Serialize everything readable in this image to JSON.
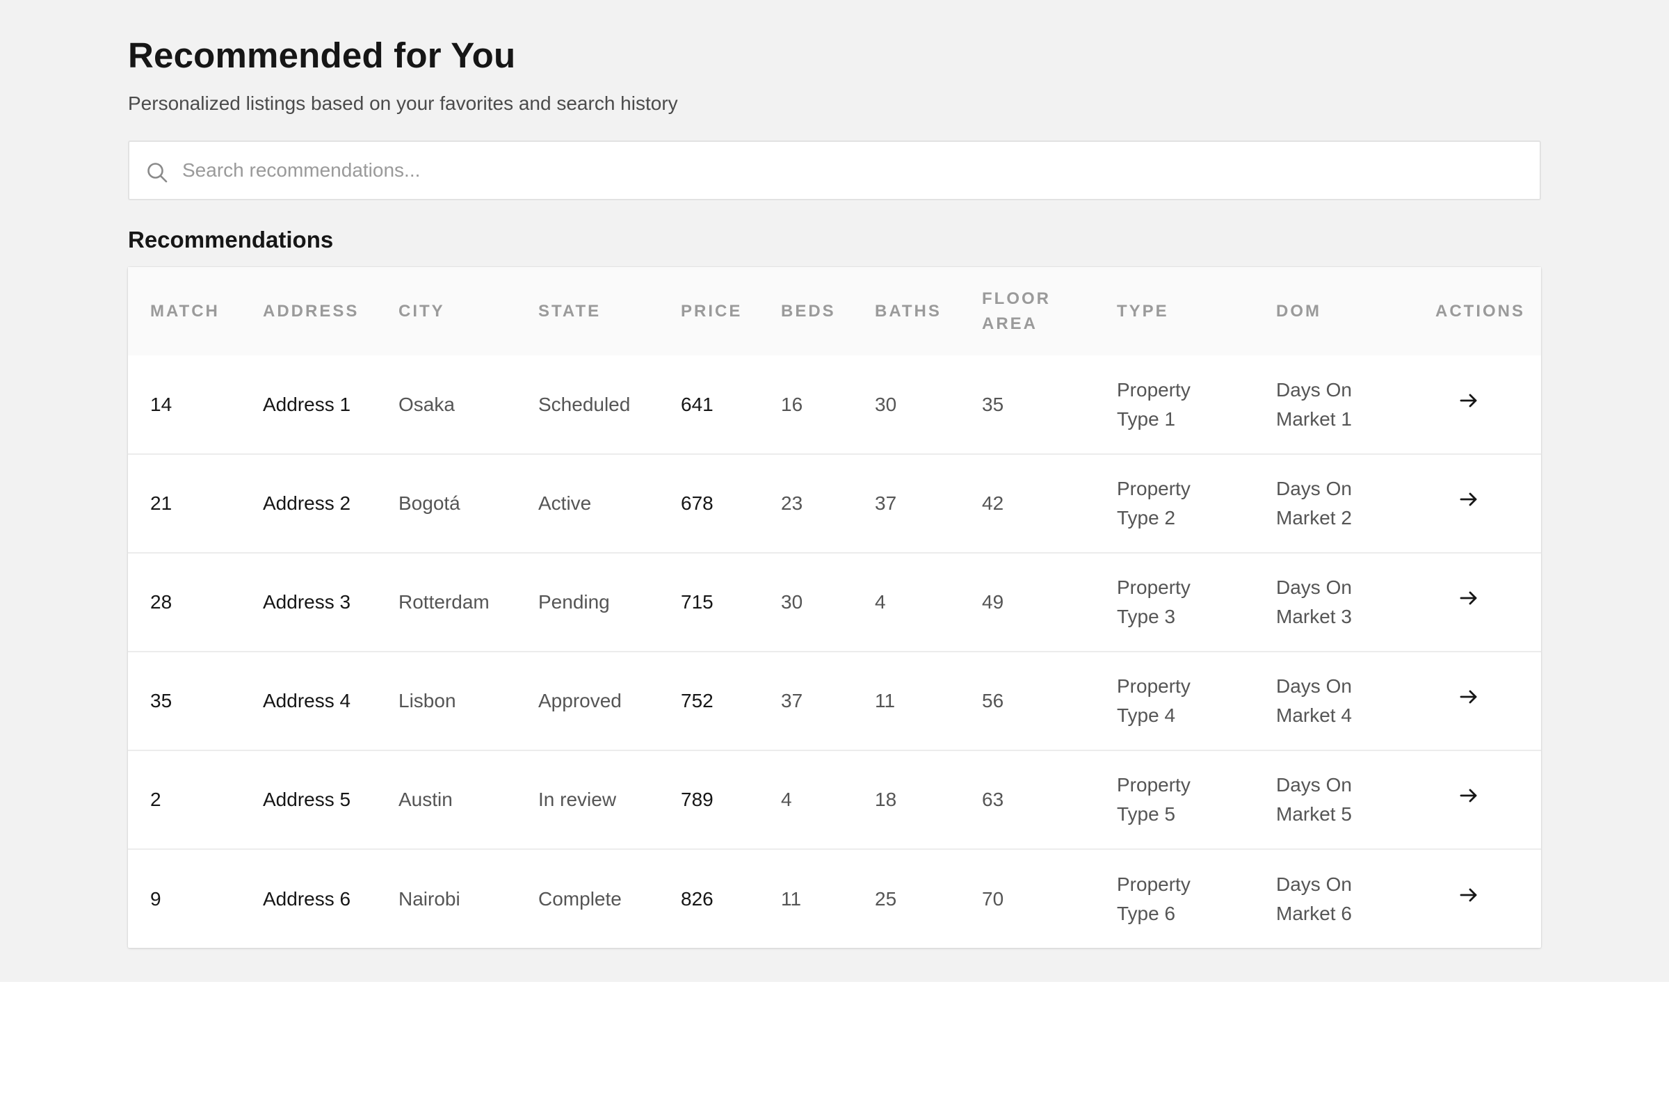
{
  "header": {
    "title": "Recommended for You",
    "subtitle": "Personalized listings based on your favorites and search history"
  },
  "search": {
    "placeholder": "Search recommendations...",
    "icon": "search-icon"
  },
  "section": {
    "heading": "Recommendations"
  },
  "table": {
    "columns": [
      "MATCH",
      "ADDRESS",
      "CITY",
      "STATE",
      "PRICE",
      "BEDS",
      "BATHS",
      "FLOOR AREA",
      "TYPE",
      "DOM",
      "ACTIONS"
    ],
    "rows": [
      {
        "match": "14",
        "address": "Address 1",
        "city": "Osaka",
        "state": "Scheduled",
        "price": "641",
        "beds": "16",
        "baths": "30",
        "floor_area": "35",
        "type": "Property Type 1",
        "dom": "Days On Market 1",
        "action_icon": "arrow-right-icon"
      },
      {
        "match": "21",
        "address": "Address 2",
        "city": "Bogotá",
        "state": "Active",
        "price": "678",
        "beds": "23",
        "baths": "37",
        "floor_area": "42",
        "type": "Property Type 2",
        "dom": "Days On Market 2",
        "action_icon": "arrow-right-icon"
      },
      {
        "match": "28",
        "address": "Address 3",
        "city": "Rotterdam",
        "state": "Pending",
        "price": "715",
        "beds": "30",
        "baths": "4",
        "floor_area": "49",
        "type": "Property Type 3",
        "dom": "Days On Market 3",
        "action_icon": "arrow-right-icon"
      },
      {
        "match": "35",
        "address": "Address 4",
        "city": "Lisbon",
        "state": "Approved",
        "price": "752",
        "beds": "37",
        "baths": "11",
        "floor_area": "56",
        "type": "Property Type 4",
        "dom": "Days On Market 4",
        "action_icon": "arrow-right-icon"
      },
      {
        "match": "2",
        "address": "Address 5",
        "city": "Austin",
        "state": "In review",
        "price": "789",
        "beds": "4",
        "baths": "18",
        "floor_area": "63",
        "type": "Property Type 5",
        "dom": "Days On Market 5",
        "action_icon": "arrow-right-icon"
      },
      {
        "match": "9",
        "address": "Address 6",
        "city": "Nairobi",
        "state": "Complete",
        "price": "826",
        "beds": "11",
        "baths": "25",
        "floor_area": "70",
        "type": "Property Type 6",
        "dom": "Days On Market 6",
        "action_icon": "arrow-right-icon"
      }
    ]
  },
  "colors": {
    "page_background": "#f2f2f2",
    "card_background": "#ffffff",
    "header_row_background": "#fafafa",
    "header_text": "#9a9a9a",
    "primary_text": "#161616",
    "secondary_text": "#555555"
  }
}
